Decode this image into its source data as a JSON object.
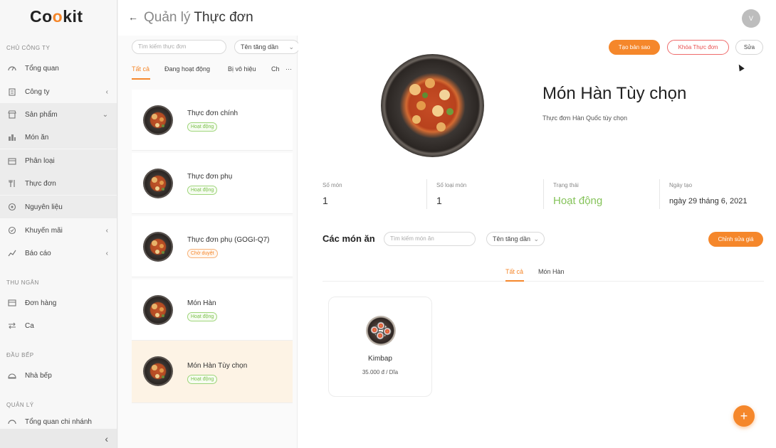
{
  "logo": {
    "prefix": "Co",
    "o2": "o",
    "suffix": "kit"
  },
  "sidebar": {
    "sections": [
      {
        "title": "CHỦ CÔNG TY"
      },
      {
        "title": "THU NGÂN"
      },
      {
        "title": "ĐẦU BẾP"
      },
      {
        "title": "QUẢN LÝ"
      }
    ],
    "items": [
      {
        "label": "Tổng quan",
        "icon": "dashboard-icon"
      },
      {
        "label": "Công ty",
        "icon": "building-icon",
        "chevron": "‹"
      },
      {
        "label": "Sản phẩm",
        "icon": "shop-icon",
        "chevron": "⌄"
      },
      {
        "label": "Món ăn",
        "icon": "dish-icon"
      },
      {
        "label": "Phân loại",
        "icon": "category-icon"
      },
      {
        "label": "Thực đơn",
        "icon": "fork-knife-icon"
      },
      {
        "label": "Nguyên liệu",
        "icon": "ingredient-icon"
      },
      {
        "label": "Khuyến mãi",
        "icon": "promo-icon",
        "chevron": "‹"
      },
      {
        "label": "Báo cáo",
        "icon": "report-icon",
        "chevron": "‹"
      },
      {
        "label": "Đơn hàng",
        "icon": "order-icon"
      },
      {
        "label": "Ca",
        "icon": "shift-icon"
      },
      {
        "label": "Nhà bếp",
        "icon": "kitchen-icon"
      },
      {
        "label": "Tổng quan chi nhánh",
        "icon": "branch-icon"
      }
    ],
    "collapse": "‹"
  },
  "header": {
    "back": "←",
    "title_prefix": "Quản lý",
    "title_bold": "Thực đơn",
    "avatar": "V"
  },
  "list": {
    "search_placeholder": "Tìm kiếm thực đơn",
    "sort": "Tên tăng dần",
    "sort_icon": "⌄",
    "tabs": [
      "Tất cả",
      "Đang hoạt động",
      "Bị vô hiệu",
      "Ch",
      "···"
    ],
    "menus": [
      {
        "name": "Thực đơn chính",
        "status": "Hoạt động",
        "status_type": "active"
      },
      {
        "name": "Thực đơn phụ",
        "status": "Hoạt động",
        "status_type": "active"
      },
      {
        "name": "Thực đơn phụ (GOGI-Q7)",
        "status": "Chờ duyệt",
        "status_type": "pending"
      },
      {
        "name": "Món Hàn",
        "status": "Hoạt động",
        "status_type": "active"
      },
      {
        "name": "Món Hàn Tùy chọn",
        "status": "Hoạt động",
        "status_type": "active"
      }
    ]
  },
  "detail": {
    "buttons": {
      "copy": "Tạo bản sao",
      "lock": "Khóa Thực đơn",
      "edit": "Sửa"
    },
    "title": "Món Hàn Tùy chọn",
    "subtitle": "Thực đơn Hàn Quốc tùy chọn",
    "stats": [
      {
        "label": "Số món",
        "value": "1"
      },
      {
        "label": "Số loại món",
        "value": "1"
      },
      {
        "label": "Trạng thái",
        "value": "Hoạt động"
      },
      {
        "label": "Ngày tạo",
        "value": "ngày 29 tháng 6, 2021"
      }
    ],
    "items_title": "Các món ăn",
    "items_search_placeholder": "Tìm kiếm món ăn",
    "items_sort": "Tên tăng dần",
    "edit_price": "Chỉnh sửa giá",
    "sub_tabs": [
      "Tất cả",
      "Món Hàn"
    ],
    "items": [
      {
        "name": "Kimbap",
        "price": "35.000 đ / Dĩa"
      }
    ],
    "fab": "+"
  },
  "colors": {
    "accent": "#f5872b",
    "active_green": "#7cc14d",
    "danger": "#e94c4c"
  }
}
